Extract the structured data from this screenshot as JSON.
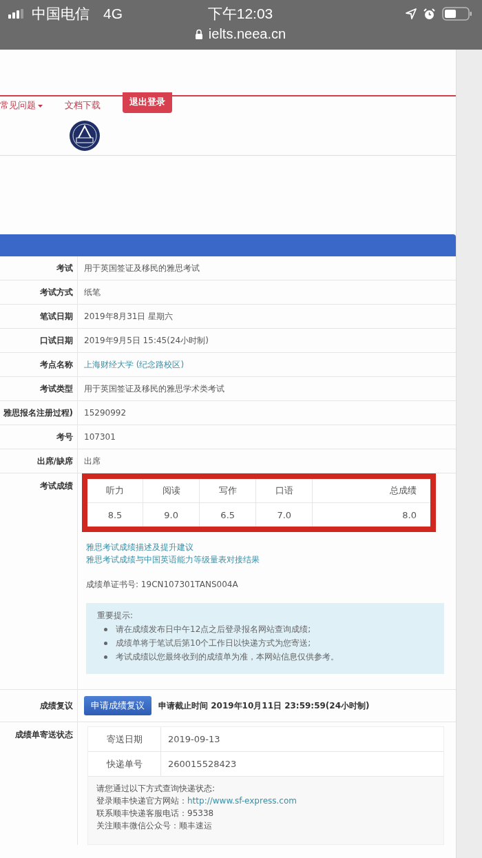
{
  "status_bar": {
    "carrier": "中国电信",
    "network": "4G",
    "time": "下午12:03",
    "url": "ielts.neea.cn"
  },
  "nav": [
    {
      "label": "常见问题",
      "kind": "dropdown"
    },
    {
      "label": "文档下载",
      "kind": "link"
    },
    {
      "label": "退出登录",
      "kind": "button"
    }
  ],
  "info_rows": [
    {
      "label": "考试",
      "value": "用于英国签证及移民的雅思考试",
      "kind": "text"
    },
    {
      "label": "考试方式",
      "value": "纸笔",
      "kind": "text"
    },
    {
      "label": "笔试日期",
      "value": "2019年8月31日  星期六",
      "kind": "text"
    },
    {
      "label": "口试日期",
      "value": "2019年9月5日  15:45(24小时制)",
      "kind": "text"
    },
    {
      "label": "考点名称",
      "value": "上海财经大学 (纪念路校区)",
      "kind": "link"
    },
    {
      "label": "考试类型",
      "value": "用于英国签证及移民的雅思学术类考试",
      "kind": "text"
    },
    {
      "label": "雅思报名注册过程)",
      "value": "15290992",
      "kind": "text"
    },
    {
      "label": "考号",
      "value": "107301",
      "kind": "text"
    },
    {
      "label": "出席/缺席",
      "value": "出席",
      "kind": "text"
    }
  ],
  "scores": {
    "label": "考试成绩",
    "columns": [
      "听力",
      "阅读",
      "写作",
      "口语",
      "总成绩"
    ],
    "values": [
      "8.5",
      "9.0",
      "6.5",
      "7.0",
      "8.0"
    ]
  },
  "score_links": [
    "雅思考试成绩描述及提升建议",
    "雅思考试成绩与中国英语能力等级量表对接结果"
  ],
  "certificate": "成绩单证书号: 19CN107301TANS004A",
  "notice": {
    "title": "重要提示:",
    "items": [
      "请在成绩发布日中午12点之后登录报名网站查询成绩;",
      "成绩单将于笔试后第10个工作日以快递方式为您寄送;",
      "考试成绩以您最终收到的成绩单为准，本网站信息仅供参考。"
    ]
  },
  "review": {
    "label": "成绩复议",
    "button": "申请成绩复议",
    "deadline": "申请截止时间 2019年10月11日 23:59:59(24小时制)"
  },
  "delivery": {
    "label": "成绩单寄送状态",
    "rows": [
      {
        "label": "寄送日期",
        "value": "2019-09-13"
      },
      {
        "label": "快递单号",
        "value": "260015528423"
      }
    ],
    "lines": [
      {
        "text": "请您通过以下方式查询快递状态:"
      },
      {
        "text": "登录顺丰快递官方网站：",
        "link": "http://www.sf-express.com"
      },
      {
        "text": "联系顺丰快递客服电话：95338"
      },
      {
        "text": "关注顺丰微信公众号：顺丰速运"
      }
    ]
  }
}
